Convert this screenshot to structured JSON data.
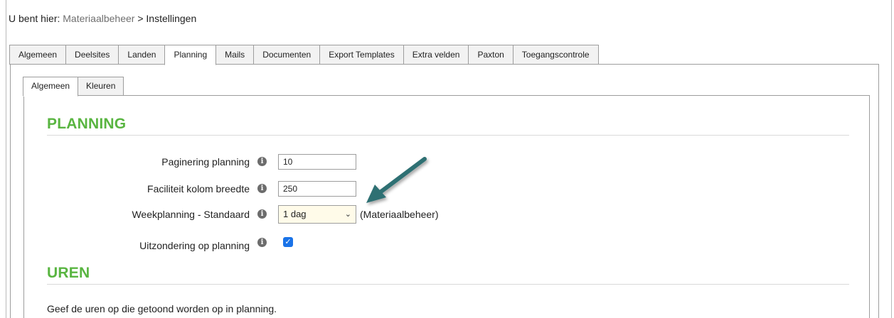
{
  "breadcrumb": {
    "prefix": "U bent hier:",
    "link": "Materiaalbeheer",
    "separator": ">",
    "current": "Instellingen"
  },
  "top_tabs": [
    {
      "label": "Algemeen"
    },
    {
      "label": "Deelsites"
    },
    {
      "label": "Landen"
    },
    {
      "label": "Planning",
      "active": true
    },
    {
      "label": "Mails"
    },
    {
      "label": "Documenten"
    },
    {
      "label": "Export Templates"
    },
    {
      "label": "Extra velden"
    },
    {
      "label": "Paxton"
    },
    {
      "label": "Toegangscontrole"
    }
  ],
  "sub_tabs": [
    {
      "label": "Algemeen",
      "active": true
    },
    {
      "label": "Kleuren"
    }
  ],
  "planning": {
    "title": "PLANNING",
    "fields": {
      "paginering_label": "Paginering planning",
      "paginering_value": "10",
      "breedte_label": "Faciliteit kolom breedte",
      "breedte_value": "250",
      "weekplanning_label": "Weekplanning - Standaard",
      "weekplanning_value": "1 dag",
      "weekplanning_note": "(Materiaalbeheer)",
      "uitzondering_label": "Uitzondering op planning",
      "uitzondering_checked": true
    }
  },
  "uren": {
    "title": "UREN",
    "description": "Geef de uren op die getoond worden op in planning."
  },
  "icons": {
    "info": "info-icon",
    "checkbox": "check-icon",
    "chevron": "chevron-down-icon",
    "arrow": "annotation-arrow"
  },
  "colors": {
    "section_title": "#59b541",
    "arrow": "#2f6f73",
    "checkbox": "#1a73e8",
    "select_bg": "#fffbe9"
  }
}
